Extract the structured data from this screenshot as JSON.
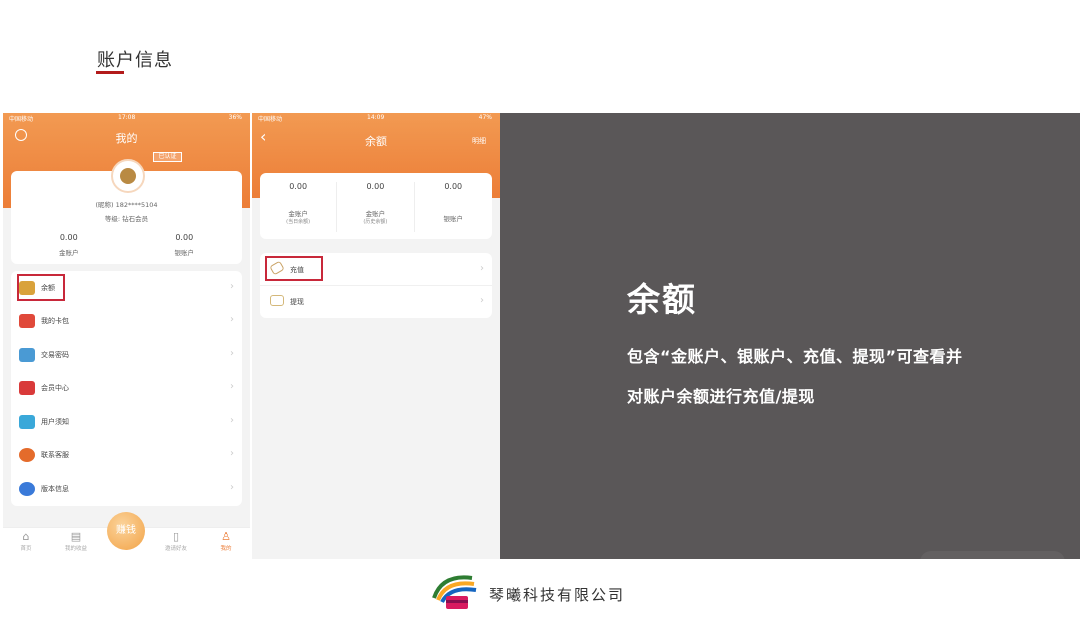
{
  "slide": {
    "title": "账户信息",
    "accent_color": "#b31b1b"
  },
  "phone_profile": {
    "status": {
      "carrier": "中国移动",
      "time": "17:08",
      "battery": "36%"
    },
    "nav_title": "我的",
    "badge": "已认证",
    "nickname": "(昵称) 182****5104",
    "level": "等级: 钻石会员",
    "balances": [
      {
        "value": "0.00",
        "label": "金账户"
      },
      {
        "value": "0.00",
        "label": "银账户"
      }
    ],
    "menu": [
      {
        "label": "余额",
        "icon": "moneybag-icon",
        "color": "#d9a23b"
      },
      {
        "label": "我的卡包",
        "icon": "wallet-icon",
        "color": "#e0493a"
      },
      {
        "label": "交易密码",
        "icon": "lock-icon",
        "color": "#4a9ad4"
      },
      {
        "label": "会员中心",
        "icon": "crown-icon",
        "color": "#d93a3a"
      },
      {
        "label": "用户须知",
        "icon": "lightbulb-icon",
        "color": "#3aa8d9"
      },
      {
        "label": "联系客服",
        "icon": "support-icon",
        "color": "#e46b2b"
      },
      {
        "label": "版本信息",
        "icon": "info-icon",
        "color": "#3a7ad9"
      }
    ],
    "tabs": [
      {
        "label": "首页",
        "icon": "home-icon"
      },
      {
        "label": "我的收益",
        "icon": "chart-icon"
      },
      {
        "label": "赚钱",
        "icon": "coin-icon"
      },
      {
        "label": "邀请好友",
        "icon": "doc-icon"
      },
      {
        "label": "我的",
        "icon": "user-icon"
      }
    ]
  },
  "phone_balance": {
    "status": {
      "carrier": "中国移动",
      "time": "14:09",
      "battery": "47%"
    },
    "nav_title": "余额",
    "nav_right": "明细",
    "accounts": [
      {
        "value": "0.00",
        "label": "金账户",
        "sub": "(当日余额)"
      },
      {
        "value": "0.00",
        "label": "金账户",
        "sub": "(历史余额)"
      },
      {
        "value": "0.00",
        "label": "银账户",
        "sub": ""
      }
    ],
    "actions": [
      {
        "label": "充值",
        "icon": "tag-icon"
      },
      {
        "label": "提现",
        "icon": "wallet-icon"
      }
    ]
  },
  "panel": {
    "heading": "余额",
    "line1": "包含“金账户、银账户、充值、提现”可查看并",
    "line2": "对账户余额进行充值/提现"
  },
  "footer": {
    "company": "琴曦科技有限公司"
  }
}
